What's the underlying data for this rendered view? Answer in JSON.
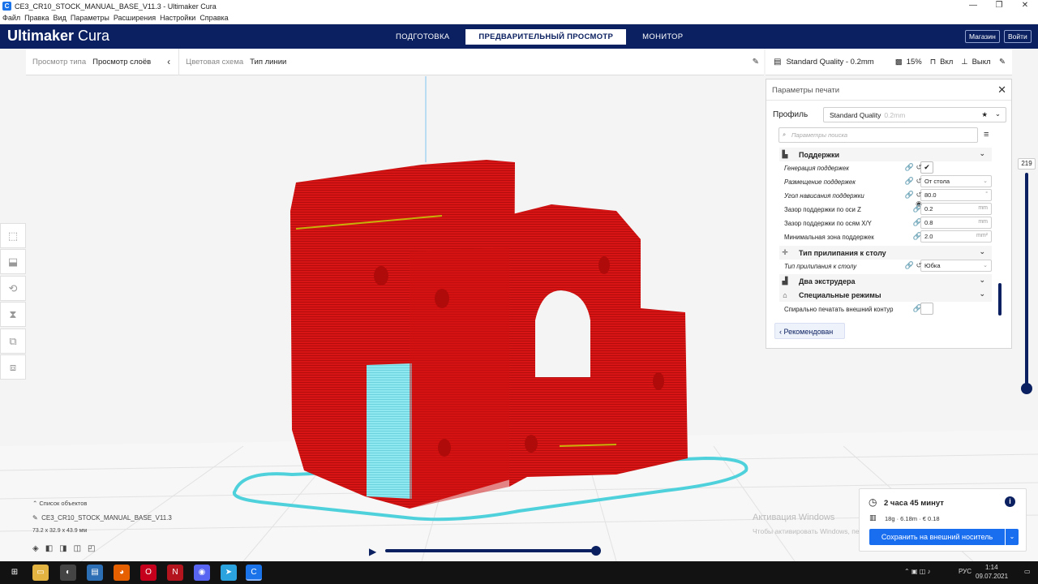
{
  "window": {
    "title": "CE3_CR10_STOCK_MANUAL_BASE_V11.3 - Ultimaker Cura",
    "controls": [
      "—",
      "❐",
      "✕"
    ]
  },
  "menu": [
    "Файл",
    "Правка",
    "Вид",
    "Параметры",
    "Расширения",
    "Настройки",
    "Справка"
  ],
  "header": {
    "logo_a": "Ultimaker",
    "logo_b": " Cura",
    "tabs": [
      "ПОДГОТОВКА",
      "ПРЕДВАРИТЕЛЬНЫЙ ПРОСМОТР",
      "МОНИТОР"
    ],
    "active_tab": "ПРЕДВАРИТЕЛЬНЫЙ ПРОСМОТР",
    "marketplace": "Магазин",
    "login": "Войти"
  },
  "viewbar": {
    "view_type_label": "Просмотр типа",
    "view_type_value": "Просмотр слоёв",
    "color_scheme_label": "Цветовая схема",
    "color_scheme_value": "Тип линии"
  },
  "printbar": {
    "profile": "Standard Quality - 0.2mm",
    "infill": "15%",
    "support": "Вкл",
    "adhesion": "Выкл"
  },
  "panel": {
    "title": "Параметры печати",
    "profile_label": "Профиль",
    "profile_value": "Standard Quality",
    "profile_sub": "0.2mm",
    "search_placeholder": "Параметры поиска",
    "cat_support": "Поддержки",
    "rows": {
      "gen": "Генерация поддержек",
      "placement": "Размещение поддержек",
      "placement_val": "От стола",
      "angle": "Угол нависания поддержки",
      "angle_val": "80.0",
      "angle_unit": "°",
      "zgap": "Зазор поддержки по оси Z",
      "zgap_val": "0.2",
      "zgap_unit": "mm",
      "xygap": "Зазор поддержки по осям X/Y",
      "xygap_val": "0.8",
      "xygap_unit": "mm",
      "minarea": "Минимальная зона поддержек",
      "minarea_val": "2.0",
      "minarea_unit": "mm²",
      "cat_adhesion": "Тип прилипания к столу",
      "adh_type": "Тип прилипания к столу",
      "adh_type_val": "Юбка",
      "cat_dual": "Два экструдера",
      "cat_special": "Специальные режимы",
      "spiral": "Спирально печатать внешний контур"
    },
    "recommended": "Рекомендован"
  },
  "layer_top": "219",
  "objects": {
    "list_label": "Список объектов",
    "name": "CE3_CR10_STOCK_MANUAL_BASE_V11.3",
    "dims": "73.2 x 32.9 x 43.9 мм"
  },
  "watermark": {
    "line1": "Активация Windows",
    "line2": "Чтобы активировать Windows, перейдите в раздел \"Параметры\"."
  },
  "estimate": {
    "time": "2 часа 45 минут",
    "material": "18g · 6.18m · € 0.18",
    "save": "Сохранить на внешний носитель"
  },
  "taskbar": {
    "lang": "РУС",
    "time": "1:14",
    "date": "09.07.2021"
  },
  "colors": {
    "brand": "#0b2060",
    "accent": "#196ef0",
    "model": "#d81414",
    "support": "#7fe3ec"
  }
}
